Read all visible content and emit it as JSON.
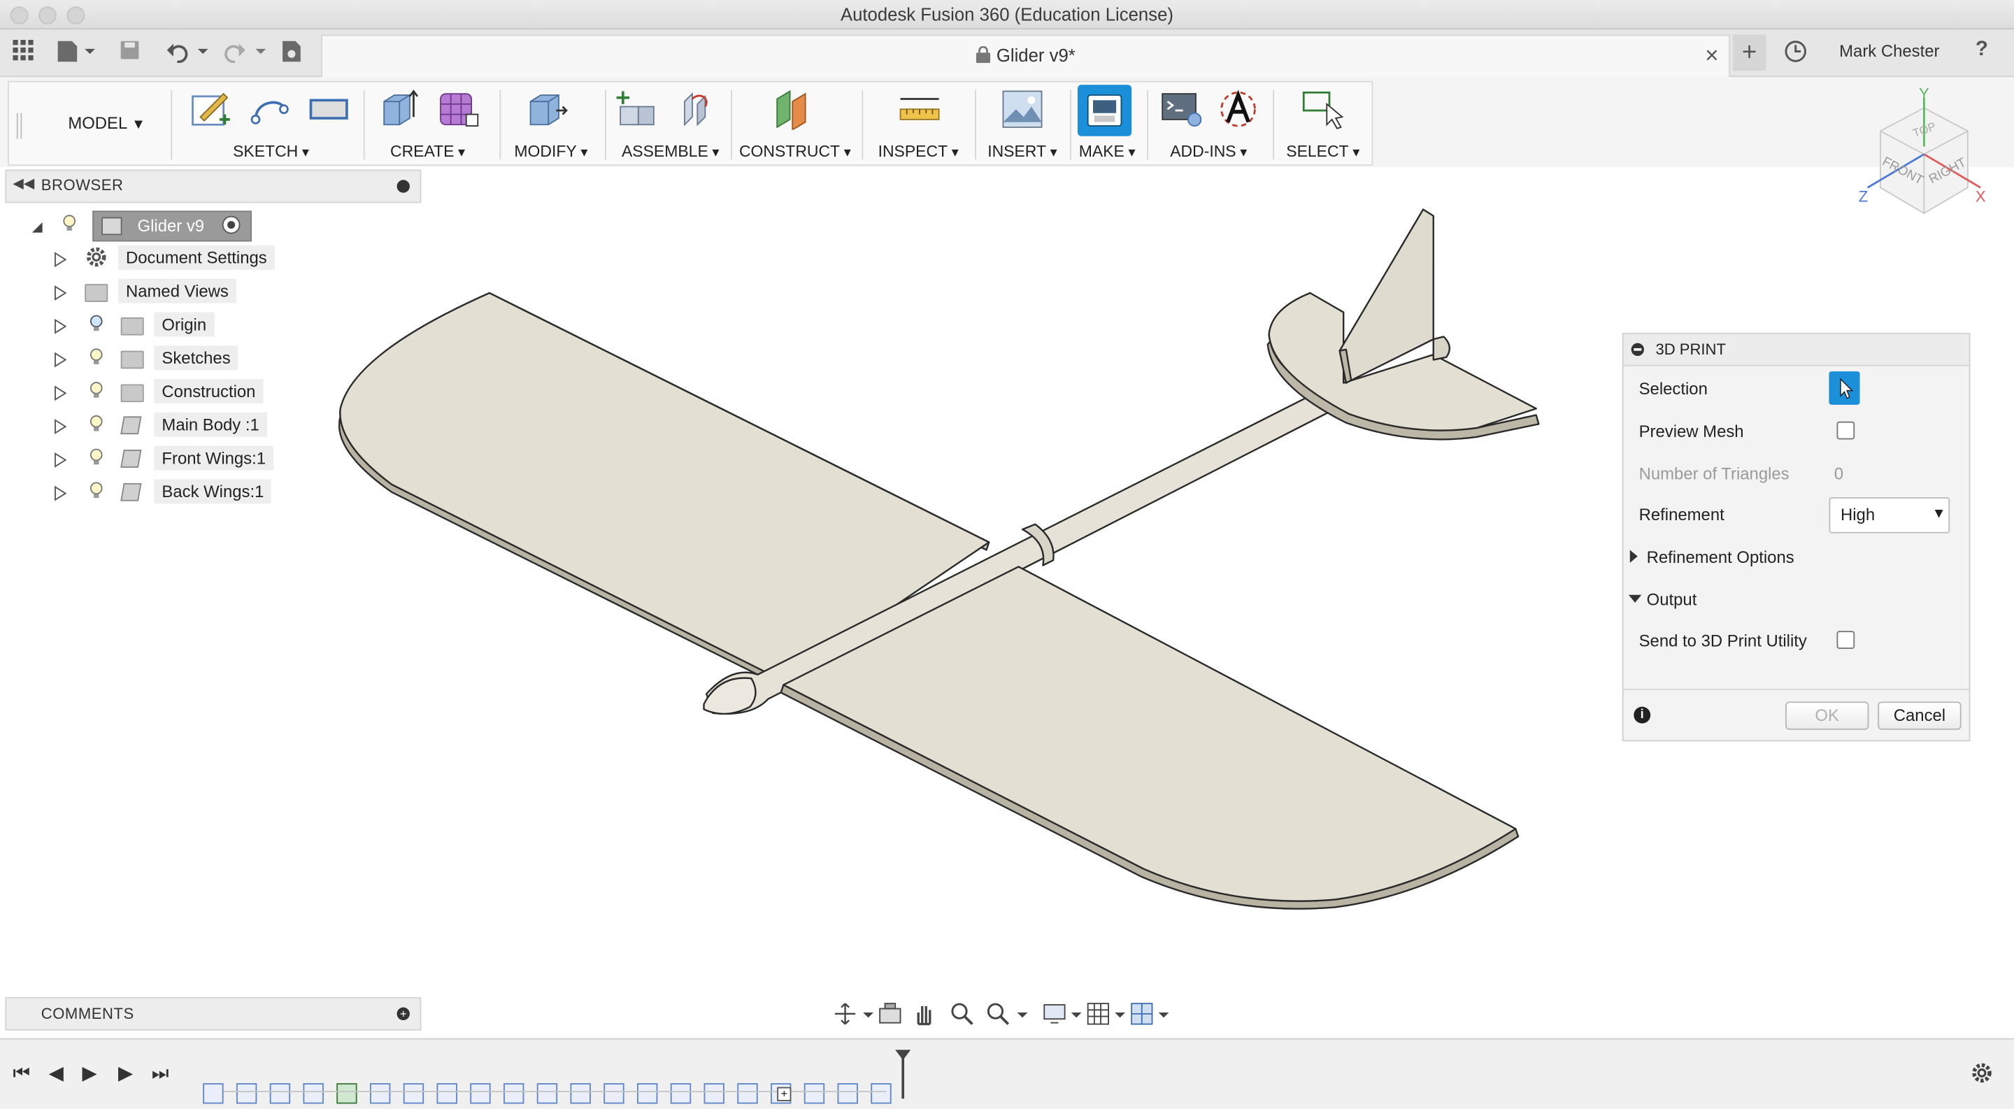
{
  "window": {
    "title": "Autodesk Fusion 360 (Education License)"
  },
  "tab": {
    "document": "Glider v9*",
    "user": "Mark Chester",
    "help": "?"
  },
  "toolbar": {
    "workspace": "MODEL",
    "groups": [
      "SKETCH",
      "CREATE",
      "MODIFY",
      "ASSEMBLE",
      "CONSTRUCT",
      "INSPECT",
      "INSERT",
      "MAKE",
      "ADD-INS",
      "SELECT"
    ]
  },
  "browser": {
    "title": "BROWSER",
    "root": "Glider v9",
    "items": [
      "Document Settings",
      "Named Views",
      "Origin",
      "Sketches",
      "Construction",
      "Main Body :1",
      "Front Wings:1",
      "Back Wings:1"
    ]
  },
  "viewcube": {
    "top": "TOP",
    "front": "FRONT",
    "right": "RIGHT",
    "x": "X",
    "y": "Y",
    "z": "Z"
  },
  "print_panel": {
    "title": "3D PRINT",
    "selection_label": "Selection",
    "preview_mesh_label": "Preview Mesh",
    "triangles_label": "Number of Triangles",
    "triangles_value": "0",
    "refinement_label": "Refinement",
    "refinement_value": "High",
    "refinement_options_label": "Refinement Options",
    "output_label": "Output",
    "send_label": "Send to 3D Print Utility",
    "ok": "OK",
    "cancel": "Cancel"
  },
  "comments": {
    "title": "COMMENTS"
  },
  "colors": {
    "accent": "#1b8fd8",
    "model": "#e3dfd3",
    "edge": "#2a2a2a"
  }
}
